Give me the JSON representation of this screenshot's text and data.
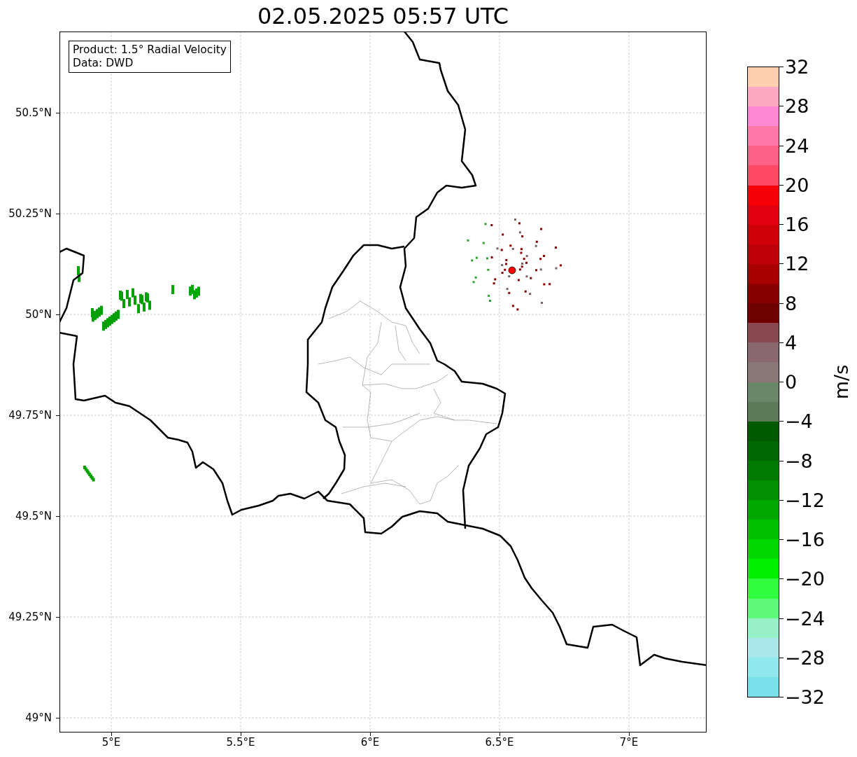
{
  "title": "02.05.2025 05:57 UTC",
  "info_box": {
    "lines": [
      "Product: 1.5° Radial Velocity",
      "Data: DWD"
    ]
  },
  "map": {
    "lat_labels": [
      "50.5°N",
      "50.25°N",
      "50°N",
      "49.75°N",
      "49.5°N",
      "49.25°N",
      "49°N"
    ],
    "lon_labels": [
      "5°E",
      "5.5°E",
      "6°E",
      "6.5°E",
      "7°E"
    ]
  },
  "colorbar": {
    "label": "m/s",
    "ticks": [
      "32",
      "28",
      "24",
      "20",
      "16",
      "12",
      "8",
      "4",
      "0",
      "−4",
      "−8",
      "−12",
      "−16",
      "−20",
      "−24",
      "−28",
      "−32"
    ],
    "segments": [
      {
        "color": "#ffcfb0"
      },
      {
        "color": "#ffa8c4"
      },
      {
        "color": "#ff88d4"
      },
      {
        "color": "#ff78a8"
      },
      {
        "color": "#ff6088"
      },
      {
        "color": "#ff4864"
      },
      {
        "color": "#f80008"
      },
      {
        "color": "#e00010"
      },
      {
        "color": "#d00008"
      },
      {
        "color": "#c00008"
      },
      {
        "color": "#a80000"
      },
      {
        "color": "#8a0000"
      },
      {
        "color": "#6e0000"
      },
      {
        "color": "#8a4850"
      },
      {
        "color": "#8a6870"
      },
      {
        "color": "#8a7878"
      },
      {
        "color": "#6a8868"
      },
      {
        "color": "#5a7a58"
      },
      {
        "color": "#005a00"
      },
      {
        "color": "#006800"
      },
      {
        "color": "#007a00"
      },
      {
        "color": "#009000"
      },
      {
        "color": "#00a800"
      },
      {
        "color": "#00c000"
      },
      {
        "color": "#00d800"
      },
      {
        "color": "#00f000"
      },
      {
        "color": "#30ff40"
      },
      {
        "color": "#60f878"
      },
      {
        "color": "#98f0c8"
      },
      {
        "color": "#a8e8ec"
      },
      {
        "color": "#90e8ec"
      },
      {
        "color": "#78e0e8"
      }
    ]
  }
}
